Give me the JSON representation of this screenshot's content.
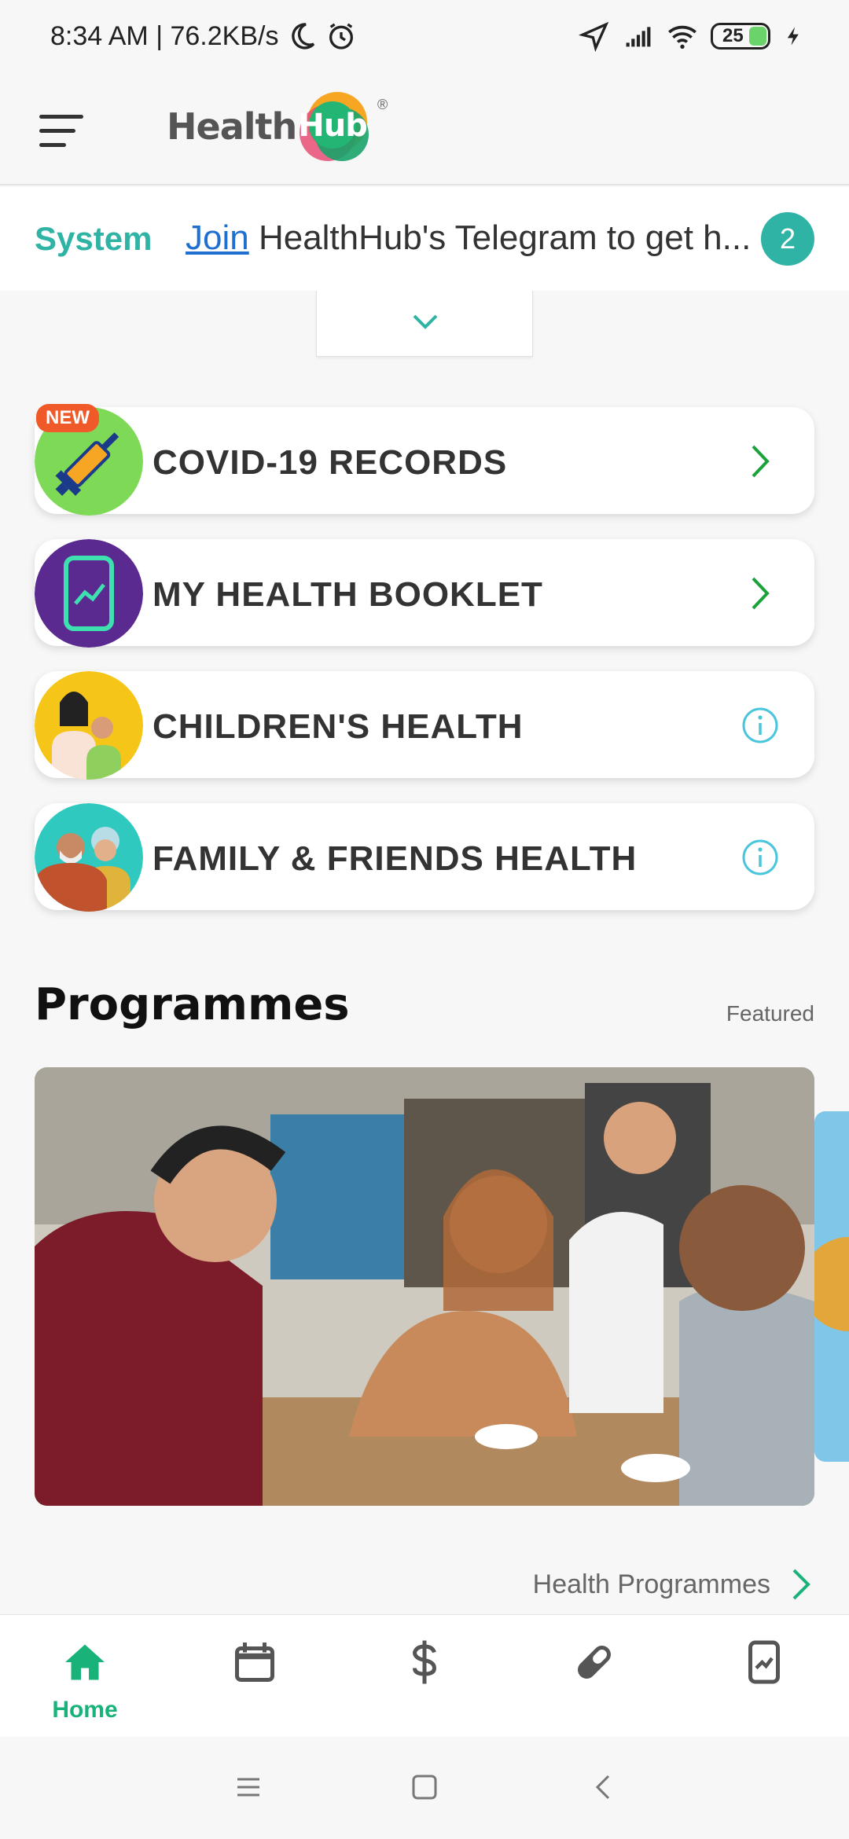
{
  "status_bar": {
    "time": "8:34 AM | 76.2KB/s",
    "battery": "25"
  },
  "header": {
    "logo_text": "Health",
    "logo_badge_text": "Hub",
    "logo_reg": "®"
  },
  "system_banner": {
    "label": "System",
    "link_text": "Join",
    "message": " HealthHub's Telegram to get h...",
    "count": "2"
  },
  "cards": [
    {
      "label": "COVID-19 RECORDS",
      "badge": "NEW",
      "icon": "vaccine-syringe-icon",
      "action": "chevron-right"
    },
    {
      "label": "MY HEALTH BOOKLET",
      "icon": "health-booklet-phone-icon",
      "action": "chevron-right"
    },
    {
      "label": "CHILDREN'S HEALTH",
      "icon": "mother-child-icon",
      "action": "info"
    },
    {
      "label": "FAMILY & FRIENDS HEALTH",
      "icon": "elderly-couple-icon",
      "action": "info"
    }
  ],
  "programmes": {
    "title": "Programmes",
    "featured_label": "Featured",
    "link_text": "Health Programmes"
  },
  "bottom_nav": [
    {
      "label": "Home",
      "icon": "home-icon",
      "active": true
    },
    {
      "label": "",
      "icon": "calendar-icon"
    },
    {
      "label": "",
      "icon": "dollar-icon"
    },
    {
      "label": "",
      "icon": "pill-icon"
    },
    {
      "label": "",
      "icon": "phone-chart-icon"
    }
  ],
  "colors": {
    "accent_teal": "#2fb3a5",
    "nav_active": "#19b37a",
    "chevron_green": "#1aa33a",
    "info_cyan": "#4ac6dc",
    "link_blue": "#1e6fd0",
    "new_badge": "#f05a28"
  }
}
